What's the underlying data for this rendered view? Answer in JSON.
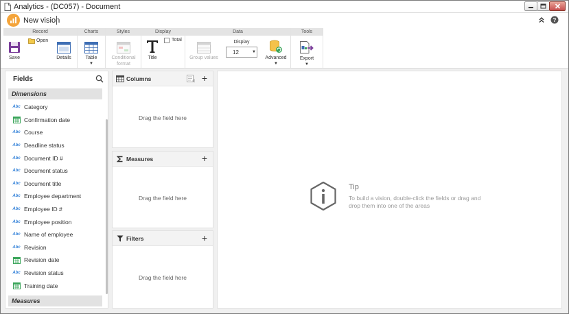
{
  "window": {
    "title": "Analytics - (DC057) - Document"
  },
  "header": {
    "vision_title": "New vision"
  },
  "ribbon": {
    "groups": {
      "record": "Record",
      "charts": "Charts",
      "styles": "Styles",
      "display": "Display",
      "data": "Data",
      "tools": "Tools"
    },
    "save": "Save",
    "open": "Open",
    "details": "Details",
    "table": "Table",
    "conditional_format": "Conditional format",
    "title": "Title",
    "total": "Total",
    "group_values": "Group values",
    "display_label": "Display",
    "display_value": "12",
    "advanced": "Advanced",
    "export": "Export"
  },
  "fields": {
    "title": "Fields",
    "dimensions_label": "Dimensions",
    "measures_label": "Measures",
    "items": [
      {
        "label": "Category",
        "icon": "text-field-icon"
      },
      {
        "label": "Confirmation date",
        "icon": "date-field-icon"
      },
      {
        "label": "Course",
        "icon": "text-field-icon"
      },
      {
        "label": "Deadline status",
        "icon": "text-field-icon"
      },
      {
        "label": "Document ID #",
        "icon": "text-field-icon"
      },
      {
        "label": "Document status",
        "icon": "text-field-icon"
      },
      {
        "label": "Document title",
        "icon": "text-field-icon"
      },
      {
        "label": "Employee department",
        "icon": "text-field-icon"
      },
      {
        "label": "Employee ID #",
        "icon": "text-field-icon"
      },
      {
        "label": "Employee position",
        "icon": "text-field-icon"
      },
      {
        "label": "Name of employee",
        "icon": "text-field-icon"
      },
      {
        "label": "Revision",
        "icon": "text-field-icon"
      },
      {
        "label": "Revision date",
        "icon": "date-field-icon"
      },
      {
        "label": "Revision status",
        "icon": "text-field-icon"
      },
      {
        "label": "Training date",
        "icon": "date-field-icon"
      }
    ]
  },
  "areas": {
    "columns": {
      "title": "Columns",
      "hint": "Drag the field here"
    },
    "measures": {
      "title": "Measures",
      "hint": "Drag the field here"
    },
    "filters": {
      "title": "Filters",
      "hint": "Drag the field here"
    }
  },
  "tip": {
    "title": "Tip",
    "text": "To build a vision, double-click the fields or drag and drop them into one of the areas"
  },
  "colors": {
    "accent_orange": "#f4a43a",
    "text_field_blue": "#2f7fd8",
    "date_field_green": "#3aa55a",
    "save_purple": "#7a3d9a"
  }
}
